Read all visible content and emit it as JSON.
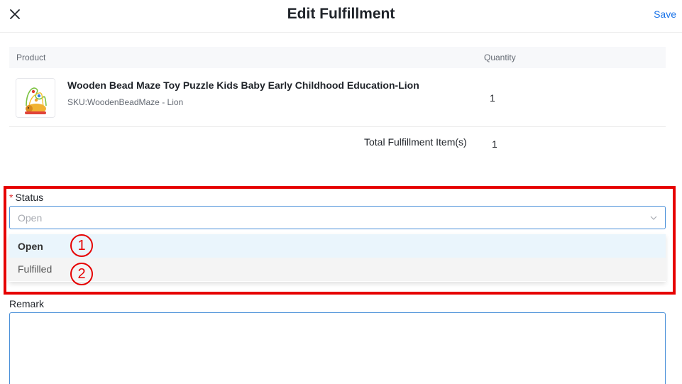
{
  "header": {
    "title": "Edit Fulfillment",
    "save_label": "Save",
    "close_icon": "close-icon"
  },
  "table": {
    "columns": [
      "Product",
      "Quantity"
    ],
    "rows": [
      {
        "name": "Wooden Bead Maze Toy Puzzle Kids Baby Early Childhood Education-Lion",
        "sku": "SKU:WoodenBeadMaze - Lion",
        "quantity": "1"
      }
    ],
    "total_label": "Total Fulfillment Item(s)",
    "total_value": "1"
  },
  "status": {
    "required_mark": "*",
    "label": "Status",
    "selected_value": "Open",
    "options": [
      "Open",
      "Fulfilled"
    ]
  },
  "annotations": {
    "markers": [
      "1",
      "2"
    ],
    "highlight_color": "#e60000"
  },
  "remark": {
    "label": "Remark",
    "value": ""
  },
  "colors": {
    "accent": "#1a73e8",
    "input_border": "#4a90d9",
    "option_hover": "#eaf5fc"
  }
}
